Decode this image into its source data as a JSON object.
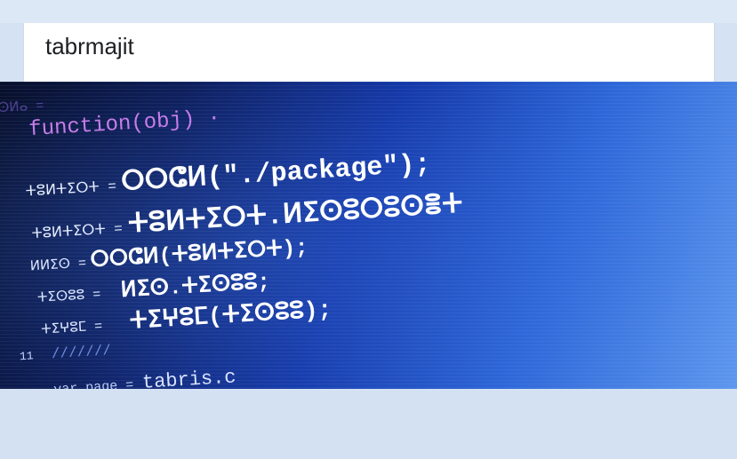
{
  "post": {
    "author": "tabrmajit"
  },
  "photo": {
    "code_lines": [
      {
        "prefix": "ⵜⴰⵙⵍⴰ =",
        "code": "function(obj) ·"
      },
      {
        "prefix": "ⵜⵓⵍⵜⵉⵔⵜ =",
        "code": "ⵔⵔⵛⵍ(\"./package\");"
      },
      {
        "prefix": "ⵜⵓⵍⵜⵉⵔⵜ =",
        "code": "ⵜⵓⵍⵜⵉⵔⵜ.ⵍⵉⵙⵓⵔⵓⵙⴻⵜ"
      },
      {
        "prefix": "ⵍⵍⵉⵙ =",
        "code": "ⵔⵔⵛⵍ(ⵜⵓⵍⵜⵉⵔⵜ);"
      },
      {
        "prefix": "ⵜⵉⵙⵓⵓ =",
        "code": "ⵍⵉⵙ.ⵜⵉⵙⵓⵓ;"
      },
      {
        "prefix": "ⵜⵉⵖⵓⵎ =",
        "code": "ⵜⵉⵖⵓⵎ(ⵜⵉⵙⵓⵓ);"
      },
      {
        "prefix": "11",
        "code": "///////"
      },
      {
        "prefix": "var page =",
        "code": "tabris.c"
      }
    ]
  },
  "colors": {
    "page_background": "#d4e2f3",
    "card_background": "#ffffff",
    "code_text": "#ffffff",
    "keyword_text": "#c77de8"
  }
}
